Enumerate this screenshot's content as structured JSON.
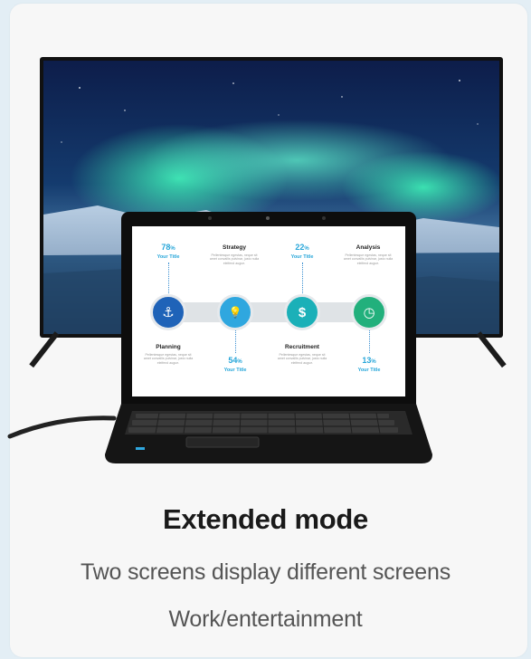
{
  "caption": {
    "title": "Extended mode",
    "line1": "Two screens display different screens",
    "line2": "Work/entertainment"
  },
  "laptop_infographic": {
    "stages": [
      {
        "value": "78",
        "unit": "%",
        "subtitle": "Your Title",
        "icon": "anchor-icon",
        "icon_glyph": "⚓",
        "color": "#1f63b8"
      },
      {
        "value": "54",
        "unit": "%",
        "subtitle": "Your Title",
        "icon": "lightbulb-icon",
        "icon_glyph": "💡",
        "color": "#2fa7df"
      },
      {
        "value": "22",
        "unit": "%",
        "subtitle": "Your Title",
        "icon": "money-bag-icon",
        "icon_glyph": "$",
        "color": "#1bb0b8"
      },
      {
        "value": "13",
        "unit": "%",
        "subtitle": "Your Title",
        "icon": "clock-icon",
        "icon_glyph": "◷",
        "color": "#22b07c"
      }
    ],
    "headings": {
      "strategy": "Strategy",
      "analysis": "Analysis",
      "planning": "Planning",
      "recruitment": "Recruitment"
    },
    "desc": "Pellentesque egestas, neque sit amet convallis pulvinar, justo nulla eleifend augue."
  },
  "colors": {
    "accent": "#27a6d9",
    "card": "#f7f7f7",
    "background": "#e3eef5"
  }
}
